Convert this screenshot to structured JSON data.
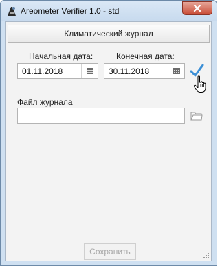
{
  "window": {
    "title": "Areometer Verifier 1.0 - std",
    "close_icon": "close-icon",
    "app_icon": "areometer-app-icon"
  },
  "header": {
    "title": "Климатический журнал"
  },
  "dates": {
    "start_label": "Начальная дата:",
    "start_value": "01.11.2018",
    "end_label": "Конечная дата:",
    "end_value": "30.11.2018",
    "calendar_icon": "calendar-icon",
    "confirm_icon": "checkmark-icon"
  },
  "file": {
    "label": "Файл журнала",
    "value": "",
    "browse_icon": "folder-icon"
  },
  "footer": {
    "save_label": "Сохранить",
    "save_enabled": false
  },
  "colors": {
    "accent_check": "#3b8fd6",
    "close_button": "#c94b35",
    "titlebar": "#cfe0f1",
    "client_bg": "#f3f3f3"
  }
}
